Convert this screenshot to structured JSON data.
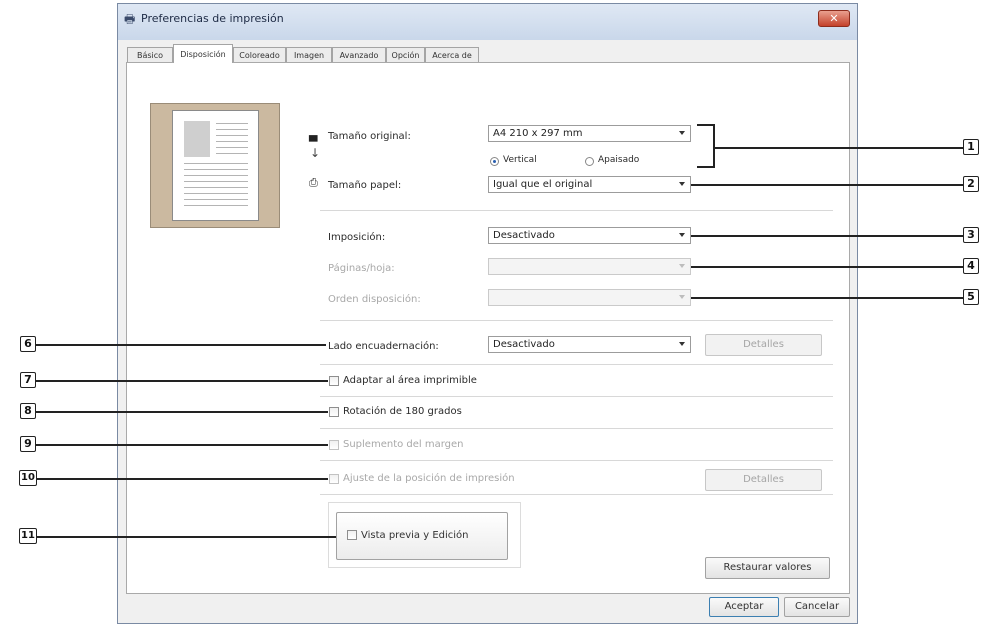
{
  "window": {
    "title": "Preferencias de impresión",
    "close_label": "✕"
  },
  "tabs": [
    {
      "label": "Básico"
    },
    {
      "label": "Disposición",
      "active": true
    },
    {
      "label": "Coloreado"
    },
    {
      "label": "Imagen"
    },
    {
      "label": "Avanzado"
    },
    {
      "label": "Opción"
    },
    {
      "label": "Acerca de"
    }
  ],
  "fields": {
    "original_size": {
      "label": "Tamaño original:",
      "value": "A4 210 x 297 mm"
    },
    "orientation": {
      "vertical_label": "Vertical",
      "landscape_label": "Apaisado",
      "selected": "Vertical"
    },
    "paper_size": {
      "label": "Tamaño papel:",
      "value": "Igual que el original"
    },
    "imposition": {
      "label": "Imposición:",
      "value": "Desactivado"
    },
    "pages_per_sheet": {
      "label": "Páginas/hoja:",
      "value": ""
    },
    "layout_order": {
      "label": "Orden disposición:",
      "value": ""
    },
    "binding_side": {
      "label": "Lado encuadernación:",
      "value": "Desactivado",
      "details_label": "Detalles"
    }
  },
  "checkboxes": {
    "fit_printable_area": {
      "label": "Adaptar al área imprimible",
      "checked": false
    },
    "rotate_180": {
      "label": "Rotación de 180 grados",
      "checked": false
    },
    "margin_supplement": {
      "label": "Suplemento del margen",
      "checked": false
    },
    "print_position": {
      "label": "Ajuste de la posición de impresión",
      "checked": false,
      "details_label": "Detalles"
    },
    "preview_edit": {
      "label": "Vista previa y Edición",
      "checked": false
    }
  },
  "buttons": {
    "restore": "Restaurar valores",
    "ok": "Aceptar",
    "cancel": "Cancelar"
  },
  "callouts": [
    "1",
    "2",
    "3",
    "4",
    "5",
    "6",
    "7",
    "8",
    "9",
    "10",
    "11"
  ]
}
